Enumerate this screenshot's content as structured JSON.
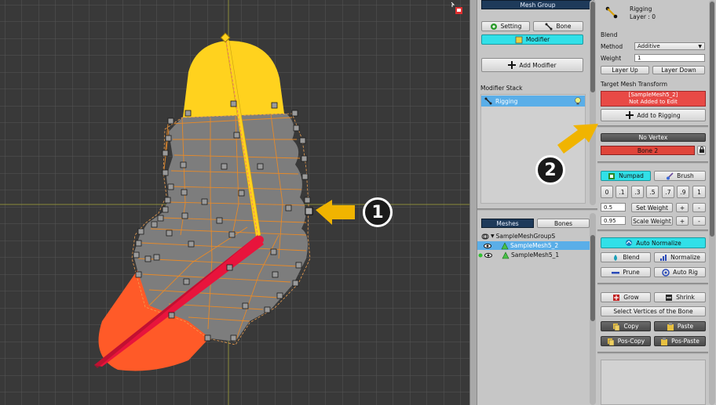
{
  "viewport": {},
  "callouts": {
    "one": "1",
    "two": "2"
  },
  "mid": {
    "header": "Mesh Group",
    "setting_label": "Setting",
    "bone_label": "Bone",
    "modifier_label": "Modifier",
    "add_modifier_label": "Add Modifier",
    "modifier_stack_label": "Modifier Stack",
    "stack_items": [
      {
        "label": "Rigging"
      }
    ],
    "meshes_tab": "Meshes",
    "bones_tab": "Bones",
    "tree": {
      "group": "SampleMeshGroupS",
      "children": [
        "SampleMesh5_2",
        "SampleMesh5_1"
      ]
    }
  },
  "right": {
    "title": "Rigging",
    "layer": "Layer : 0",
    "blend_label": "Blend",
    "method_label": "Method",
    "method_value": "Additive",
    "weight_label": "Weight",
    "weight_value": "1",
    "layer_up": "Layer Up",
    "layer_down": "Layer Down",
    "target_label": "Target Mesh Transform",
    "target_name": "[SampleMesh5_2]",
    "target_status": "Not Added to Edit",
    "add_to_rigging": "Add to Rigging",
    "no_vertex": "No Vertex",
    "bone_name": "Bone 2",
    "numpad": "Numpad",
    "brush": "Brush",
    "numpad_values": [
      "0",
      ".1",
      ".3",
      ".5",
      ".7",
      ".9",
      "1"
    ],
    "set_weight_value": "0.5",
    "set_weight": "Set Weight",
    "scale_weight_value": "0.95",
    "scale_weight": "Scale Weight",
    "plus": "+",
    "minus": "-",
    "auto_normalize": "Auto Normalize",
    "blend": "Blend",
    "normalize": "Normalize",
    "prune": "Prune",
    "auto_rig": "Auto Rig",
    "grow": "Grow",
    "shrink": "Shrink",
    "select_vertices": "Select Vertices of the Bone",
    "copy": "Copy",
    "paste": "Paste",
    "pos_copy": "Pos-Copy",
    "pos_paste": "Pos-Paste"
  },
  "colors": {
    "accent_cyan": "#31e0e8",
    "bone_red": "#e0453a",
    "selection_blue": "#5aaee8",
    "header_navy": "#1e3a5a",
    "mesh_yellow": "#ffd21e",
    "mesh_orange": "#ff5a28",
    "bone_pink": "#e8143c",
    "callout_arrow": "#f0b400"
  }
}
